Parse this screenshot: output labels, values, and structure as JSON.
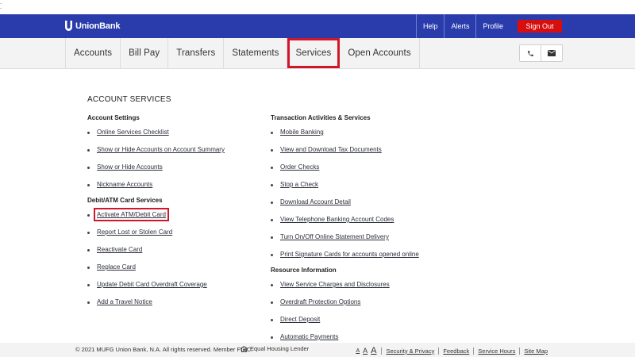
{
  "header": {
    "brand": "UnionBank",
    "links": [
      "Help",
      "Alerts",
      "Profile"
    ],
    "signout_label": "Sign Out"
  },
  "nav": {
    "items": [
      "Accounts",
      "Bill Pay",
      "Transfers",
      "Statements",
      "Services",
      "Open Accounts"
    ],
    "active": "Services"
  },
  "contact_icons": [
    "phone-icon",
    "mail-icon"
  ],
  "page": {
    "title": "ACCOUNT SERVICES",
    "left_sections": [
      {
        "title": "Account Settings",
        "links": [
          "Online Services Checklist",
          "Show or Hide Accounts on Account Summary",
          "Show or Hide Accounts",
          "Nickname Accounts"
        ]
      },
      {
        "title": "Debit/ATM Card Services",
        "links": [
          "Activate ATM/Debit Card",
          "Report Lost or Stolen Card",
          "Reactivate Card",
          "Replace Card",
          "Update Debit Card Overdraft Coverage",
          "Add a Travel Notice"
        ]
      }
    ],
    "right_sections": [
      {
        "title": "Transaction Activities & Services",
        "links": [
          "Mobile Banking",
          "View and Download Tax Documents",
          "Order Checks",
          "Stop a Check",
          "Download Account Detail",
          "View Telephone Banking Account Codes",
          "Turn On/Off Online Statement Delivery",
          "Print Signature Cards for accounts opened online"
        ]
      },
      {
        "title": "Resource Information",
        "links": [
          "View Service Charges and Disclosures",
          "Overdraft Protection Options",
          "Direct Deposit",
          "Automatic Payments"
        ]
      }
    ]
  },
  "footer": {
    "copyright": "© 2021 MUFG Union Bank, N.A. All rights reserved. Member FDIC.",
    "equal_housing": "Equal Housing Lender",
    "font_sizes": [
      "A",
      "A",
      "A"
    ],
    "links": [
      "Security & Privacy",
      "Feedback",
      "Service Hours",
      "Site Map"
    ]
  },
  "colors": {
    "brand_blue": "#2a3cac",
    "signout_red": "#d60e0e",
    "highlight_red": "#d0162a"
  }
}
